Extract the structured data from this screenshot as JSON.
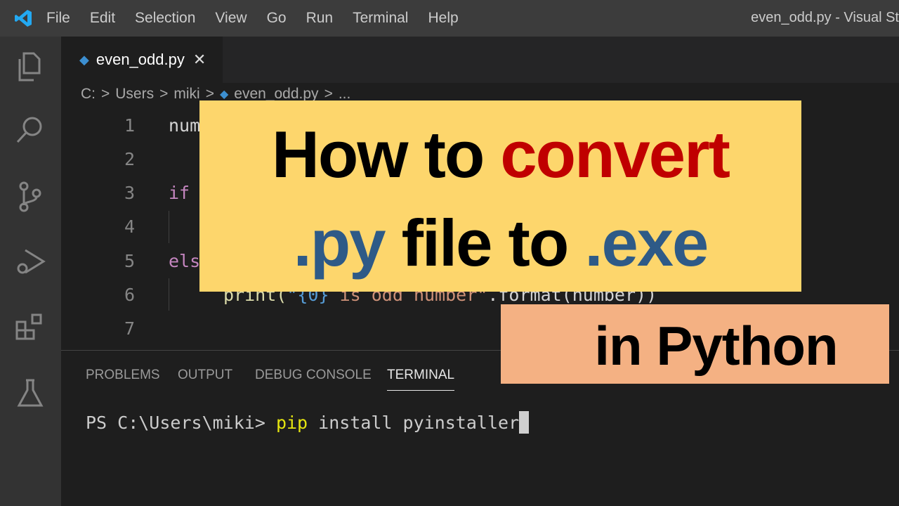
{
  "titlebar": {
    "menu": [
      "File",
      "Edit",
      "Selection",
      "View",
      "Go",
      "Run",
      "Terminal",
      "Help"
    ],
    "window_title": "even_odd.py - Visual St"
  },
  "tab": {
    "label": "even_odd.py",
    "close": "✕"
  },
  "breadcrumb": [
    "C:",
    ">",
    "Users",
    ">",
    "miki",
    ">",
    "even_odd.py",
    ">",
    "..."
  ],
  "editor": {
    "line_numbers": [
      "1",
      "2",
      "3",
      "4",
      "5",
      "6",
      "7"
    ],
    "line1": "num",
    "line3": "if",
    "line5": "els",
    "line6_a": "print(",
    "line6_b": "\"{0}",
    "line6_c": " is odd number\"",
    ".format": ".format(number))"
  },
  "panel": {
    "tabs": [
      "PROBLEMS",
      "OUTPUT",
      "DEBUG CONSOLE",
      "TERMINAL"
    ],
    "prompt": "PS C:\\Users\\miki> ",
    "cmd": "pip",
    "args": " install pyinstaller"
  },
  "overlay": {
    "w1": "How to ",
    "w2": "convert",
    "w3": ".py",
    "w4": " file to ",
    "w5": ".exe",
    "sub": "in Python"
  },
  "colors": {
    "red": "#c00000",
    "blue": "#2e5a87",
    "yellow": "#fdd66c",
    "orange": "#f4b183"
  }
}
